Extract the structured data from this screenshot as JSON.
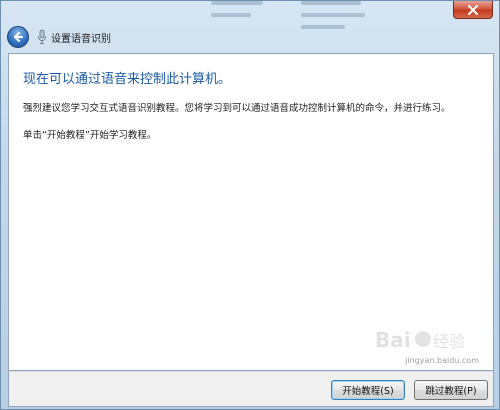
{
  "window": {
    "title": "设置语音识别",
    "back_icon": "back-arrow-icon",
    "mic_icon": "microphone-icon",
    "close_icon": "close-icon"
  },
  "content": {
    "heading": "现在可以通过语音来控制此计算机。",
    "paragraph_1": "强烈建议您学习交互式语音识别教程。您将学习到可以通过语音成功控制计算机的命令，并进行练习。",
    "paragraph_2": "单击“开始教程”开始学习教程。"
  },
  "buttons": {
    "start": "开始教程(S)",
    "skip": "跳过教程(P)"
  },
  "watermark": {
    "logo_text": "Baidu 经验",
    "url": "jingyan.baidu.com"
  },
  "colors": {
    "heading": "#1b5aa5",
    "frame": "#c4d7ea",
    "close": "#c4381b"
  }
}
